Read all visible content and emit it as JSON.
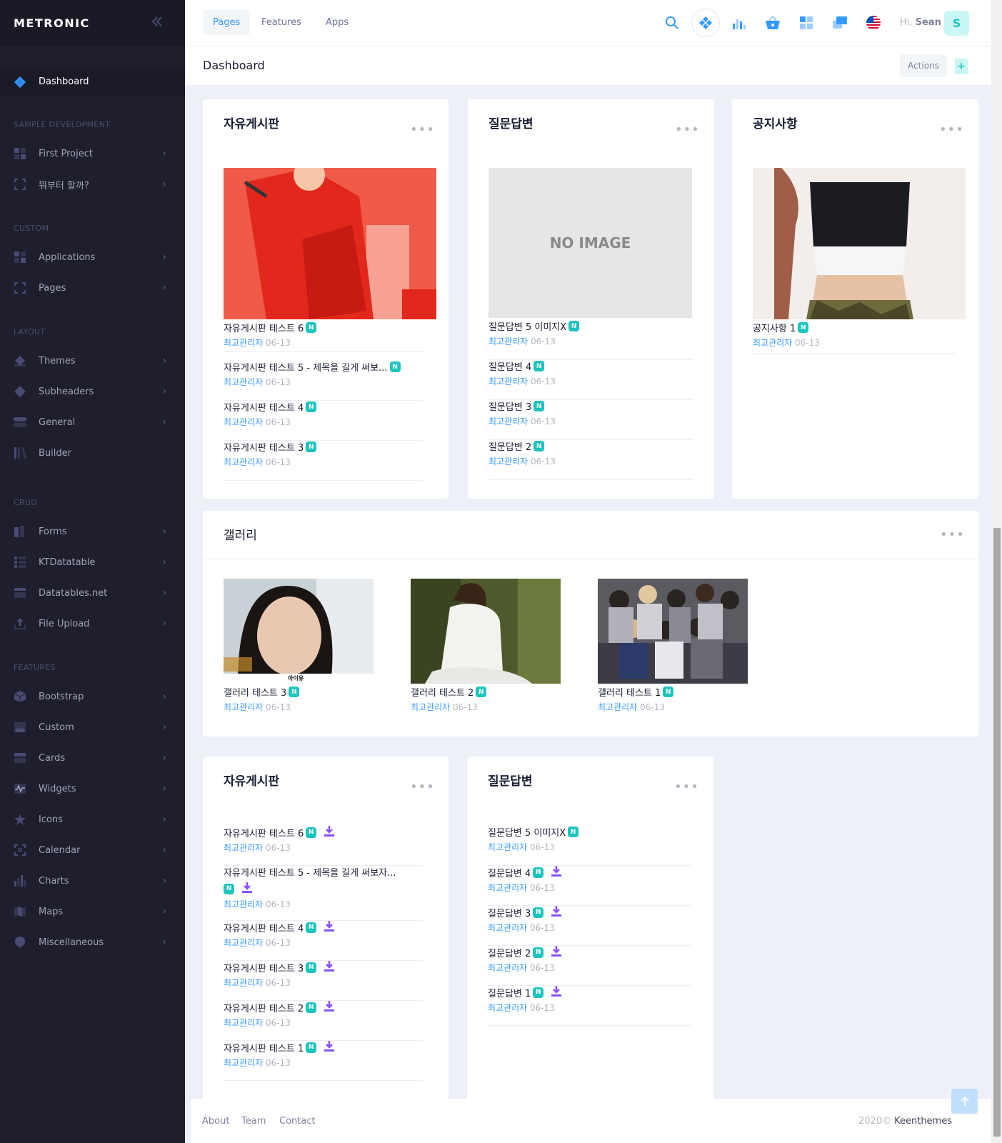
{
  "brand": {
    "name": "METRONIC"
  },
  "sidebar": {
    "active": {
      "label": "Dashboard"
    },
    "sections": {
      "sample": "SAMPLE DEVELOPMENT",
      "custom": "CUSTOM",
      "layout": "LAYOUT",
      "crud": "CRUD",
      "features": "FEATURES"
    },
    "items": {
      "first_project": "First Project",
      "where_start": "뭐부터 할까?",
      "applications": "Applications",
      "pages": "Pages",
      "themes": "Themes",
      "subheaders": "Subheaders",
      "general": "General",
      "builder": "Builder",
      "forms": "Forms",
      "ktdatatable": "KTDatatable",
      "datatables": "Datatables.net",
      "file_upload": "File Upload",
      "bootstrap": "Bootstrap",
      "custom": "Custom",
      "cards": "Cards",
      "widgets": "Widgets",
      "icons": "Icons",
      "calendar": "Calendar",
      "charts": "Charts",
      "maps": "Maps",
      "misc": "Miscellaneous"
    }
  },
  "header": {
    "tabs": [
      "Pages",
      "Features",
      "Apps"
    ],
    "greeting": "Hi,",
    "user_name": "Sean",
    "avatar_letter": "S"
  },
  "subheader": {
    "title": "Dashboard",
    "actions_label": "Actions",
    "add_label": "+"
  },
  "cards": {
    "free_board": {
      "title": "자유게시판",
      "posts": [
        {
          "title": "자유게시판 테스트 6",
          "author": "최고관리자",
          "date": "06-13"
        },
        {
          "title": "자유게시판 테스트 5 - 제목을 길게 써보...",
          "author": "최고관리자",
          "date": "06-13"
        },
        {
          "title": "자유게시판 테스트 4",
          "author": "최고관리자",
          "date": "06-13"
        },
        {
          "title": "자유게시판 테스트 3",
          "author": "최고관리자",
          "date": "06-13"
        }
      ]
    },
    "qna": {
      "title": "질문답변",
      "no_image": "NO IMAGE",
      "posts": [
        {
          "title": "질문답변 5 이미지X",
          "author": "최고관리자",
          "date": "06-13"
        },
        {
          "title": "질문답변 4",
          "author": "최고관리자",
          "date": "06-13"
        },
        {
          "title": "질문답변 3",
          "author": "최고관리자",
          "date": "06-13"
        },
        {
          "title": "질문답변 2",
          "author": "최고관리자",
          "date": "06-13"
        }
      ]
    },
    "notice": {
      "title": "공지사항",
      "posts": [
        {
          "title": "공지사항 1",
          "author": "최고관리자",
          "date": "06-13"
        }
      ]
    },
    "gallery": {
      "title": "갤러리",
      "items": [
        {
          "title": "갤러리 테스트 3",
          "author": "최고관리자",
          "date": "06-13",
          "caption": "아이유"
        },
        {
          "title": "갤러리 테스트 2",
          "author": "최고관리자",
          "date": "06-13"
        },
        {
          "title": "갤러리 테스트 1",
          "author": "최고관리자",
          "date": "06-13"
        }
      ]
    },
    "free_board_list": {
      "title": "자유게시판",
      "posts": [
        {
          "title": "자유게시판 테스트 6",
          "author": "최고관리자",
          "date": "06-13"
        },
        {
          "title": "자유게시판 테스트 5 - 제목을 길게 써보자...",
          "author": "최고관리자",
          "date": "06-13"
        },
        {
          "title": "자유게시판 테스트 4",
          "author": "최고관리자",
          "date": "06-13"
        },
        {
          "title": "자유게시판 테스트 3",
          "author": "최고관리자",
          "date": "06-13"
        },
        {
          "title": "자유게시판 테스트 2",
          "author": "최고관리자",
          "date": "06-13"
        },
        {
          "title": "자유게시판 테스트 1",
          "author": "최고관리자",
          "date": "06-13"
        }
      ]
    },
    "qna_list": {
      "title": "질문답변",
      "posts": [
        {
          "title": "질문답변 5 이미지X",
          "author": "최고관리자",
          "date": "06-13"
        },
        {
          "title": "질문답변 4",
          "author": "최고관리자",
          "date": "06-13"
        },
        {
          "title": "질문답변 3",
          "author": "최고관리자",
          "date": "06-13"
        },
        {
          "title": "질문답변 2",
          "author": "최고관리자",
          "date": "06-13"
        },
        {
          "title": "질문답변 1",
          "author": "최고관리자",
          "date": "06-13"
        }
      ]
    },
    "badge": "N"
  },
  "footer": {
    "links": [
      "About",
      "Team",
      "Contact"
    ],
    "year": "2020©",
    "company": "Keenthemes"
  },
  "colors": {
    "sidebar_bg": "#1e1e2d",
    "accent": "#3699ff",
    "badge": "#1bc5bd",
    "download": "#8950fc"
  }
}
